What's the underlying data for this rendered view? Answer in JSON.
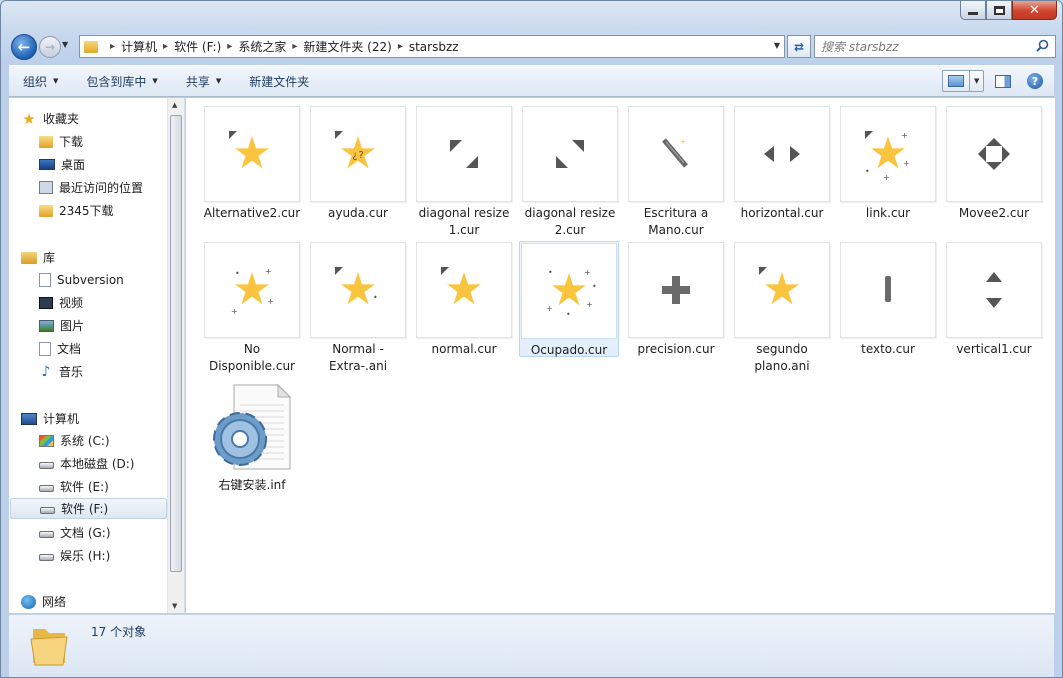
{
  "window": {
    "caption": {
      "minimize": "minimize",
      "maximize": "maximize",
      "close": "✕"
    }
  },
  "nav": {
    "breadcrumbs": [
      "计算机",
      "软件 (F:)",
      "系统之家",
      "新建文件夹 (22)",
      "starsbzz"
    ],
    "search_placeholder": "搜索 starsbzz"
  },
  "toolbar": {
    "organize": "组织",
    "include_in_library": "包含到库中",
    "share": "共享",
    "new_folder": "新建文件夹"
  },
  "sidebar": {
    "favorites": {
      "label": "收藏夹",
      "items": [
        "下载",
        "桌面",
        "最近访问的位置",
        "2345下载"
      ]
    },
    "libraries": {
      "label": "库",
      "items": [
        "Subversion",
        "视频",
        "图片",
        "文档",
        "音乐"
      ]
    },
    "computer": {
      "label": "计算机",
      "items": [
        "系统 (C:)",
        "本地磁盘 (D:)",
        "软件 (E:)",
        "软件 (F:)",
        "文档 (G:)",
        "娱乐 (H:)"
      ],
      "selected_index": 3
    },
    "network": {
      "label": "网络"
    }
  },
  "files": [
    {
      "name": "Alternative2.cur",
      "icon": "star-cursor-icon"
    },
    {
      "name": "ayuda.cur",
      "icon": "star-help-cursor-icon"
    },
    {
      "name": "diagonal resize 1.cur",
      "icon": "diagonal-resize-1-icon"
    },
    {
      "name": "diagonal resize 2.cur",
      "icon": "diagonal-resize-2-icon"
    },
    {
      "name": "Escritura a Mano.cur",
      "icon": "pen-cursor-icon"
    },
    {
      "name": "horizontal.cur",
      "icon": "horizontal-resize-icon"
    },
    {
      "name": "link.cur",
      "icon": "star-link-cursor-icon"
    },
    {
      "name": "Movee2.cur",
      "icon": "move-cursor-icon"
    },
    {
      "name": "No Disponible.cur",
      "icon": "star-unavailable-cursor-icon"
    },
    {
      "name": "Normal -Extra-.ani",
      "icon": "star-normal-extra-cursor-icon"
    },
    {
      "name": "normal.cur",
      "icon": "star-normal-cursor-icon"
    },
    {
      "name": "Ocupado.cur",
      "icon": "star-busy-cursor-icon"
    },
    {
      "name": "precision.cur",
      "icon": "precision-cursor-icon"
    },
    {
      "name": "segundo plano.ani",
      "icon": "star-background-cursor-icon"
    },
    {
      "name": "texto.cur",
      "icon": "text-cursor-icon"
    },
    {
      "name": "vertical1.cur",
      "icon": "vertical-resize-icon"
    },
    {
      "name": "右键安装.inf",
      "icon": "setup-gear-file-icon"
    }
  ],
  "status": {
    "count_text": "17 个对象"
  }
}
